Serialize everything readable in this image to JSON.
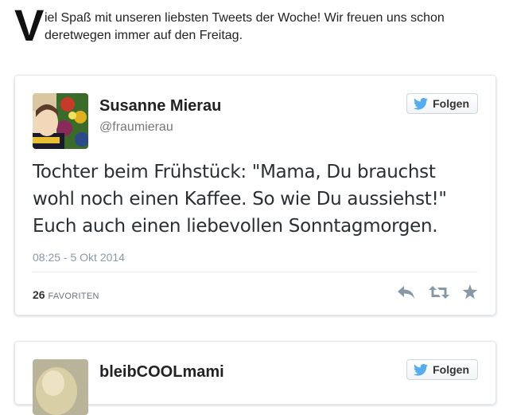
{
  "intro": {
    "dropcap": "V",
    "text": "iel Spaß mit unseren liebsten Tweets der Woche! Wir freuen uns schon deretwegen immer auf den Freitag."
  },
  "tweets": [
    {
      "name": "Susanne Mierau",
      "handle": "@fraumierau",
      "follow_label": "Folgen",
      "text": "Tochter beim Frühstück: \"Mama, Du brauchst wohl noch einen Kaffee. So wie Du aussiehst!\" Euch auch einen liebevollen Sonntagmorgen.",
      "timestamp": "08:25 - 5 Okt 2014",
      "favorites_count": "26",
      "favorites_label": "FAVORITEN"
    },
    {
      "name": "bleibCOOLmami",
      "follow_label": "Folgen"
    }
  ],
  "icons": {
    "follow": "twitter-bird-icon",
    "reply": "reply-icon",
    "retweet": "retweet-icon",
    "favorite": "star-icon"
  },
  "colors": {
    "twitter_blue": "#55acee",
    "action_gray": "#8899a6"
  }
}
